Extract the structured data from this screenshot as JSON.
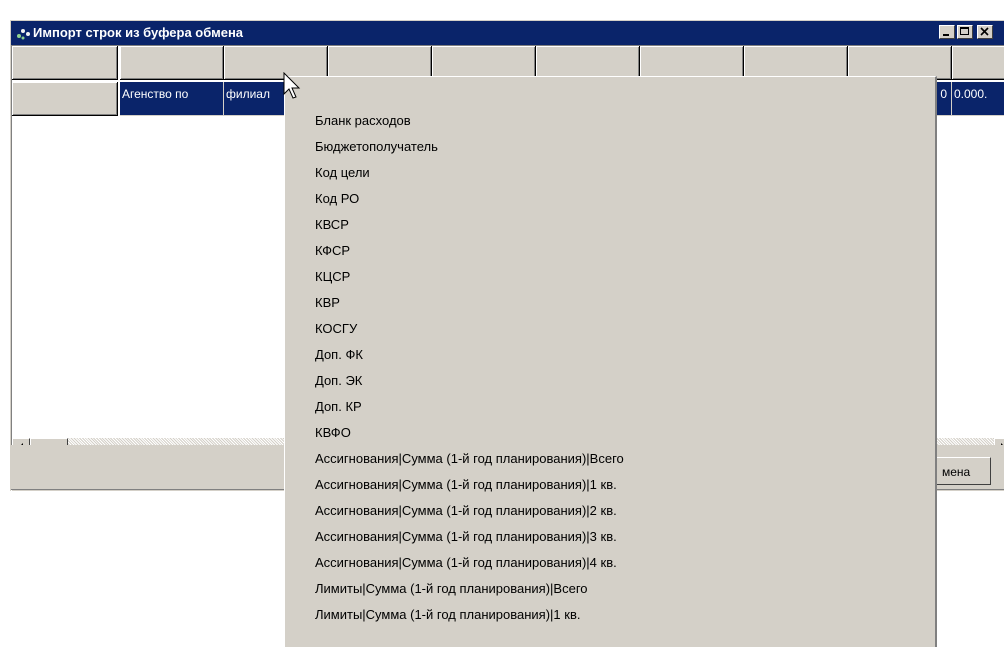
{
  "window": {
    "title": "Импорт строк из буфера обмена"
  },
  "grid": {
    "selected_row": [
      "Агенство по",
      "филиал",
      "",
      "",
      "",
      "",
      "",
      "",
      "0",
      "0.000."
    ]
  },
  "footer": {
    "cancel_label": "мена"
  },
  "menu": {
    "items": [
      "Бланк расходов",
      "Бюджетополучатель",
      "Код цели",
      "Код РО",
      "КВСР",
      "КФСР",
      "КЦСР",
      "КВР",
      "КОСГУ",
      "Доп. ФК",
      "Доп. ЭК",
      "Доп. КР",
      "КВФО",
      "Ассигнования|Сумма (1-й год планирования)|Всего",
      "Ассигнования|Сумма (1-й год планирования)|1 кв.",
      "Ассигнования|Сумма (1-й год планирования)|2 кв.",
      "Ассигнования|Сумма (1-й год планирования)|3 кв.",
      "Ассигнования|Сумма (1-й год планирования)|4 кв.",
      "Лимиты|Сумма (1-й год планирования)|Всего",
      "Лимиты|Сумма (1-й год планирования)|1 кв."
    ]
  }
}
